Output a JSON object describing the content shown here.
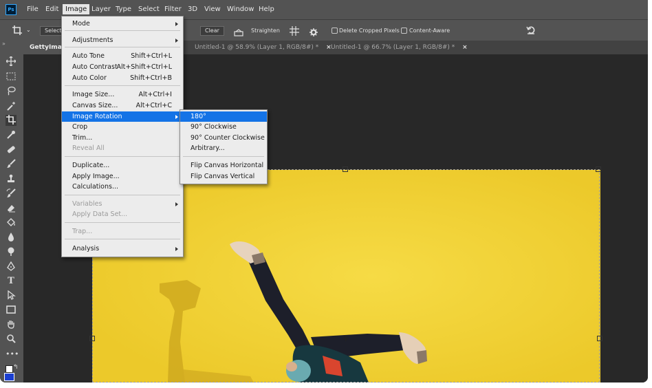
{
  "app": {
    "logo": "Ps",
    "accent": "#31a8ff"
  },
  "menubar": {
    "items": [
      "File",
      "Edit",
      "Image",
      "Layer",
      "Type",
      "Select",
      "Filter",
      "3D",
      "View",
      "Window",
      "Help"
    ],
    "active": "Image"
  },
  "options": {
    "select_partial": "Selecti",
    "clear": "Clear",
    "straighten": "Straighten",
    "delete_cropped": "Delete Cropped Pixels",
    "content_aware": "Content-Aware"
  },
  "tabs": [
    {
      "label": "GettyImag",
      "active": true
    },
    {
      "label": "Untitled-1 @ 58.9% (Layer 1, RGB/8#) *",
      "close": "×"
    },
    {
      "label": "Untitled-1 @ 66.7% (Layer 1, RGB/8#) *",
      "close": "×"
    }
  ],
  "image_menu": {
    "items": [
      {
        "label": "Mode",
        "submenu": true
      },
      {
        "label": "Adjustments",
        "submenu": true
      },
      {
        "label": "Auto Tone",
        "shortcut": "Shift+Ctrl+L"
      },
      {
        "label": "Auto Contrast",
        "shortcut": "Alt+Shift+Ctrl+L"
      },
      {
        "label": "Auto Color",
        "shortcut": "Shift+Ctrl+B"
      },
      {
        "label": "Image Size...",
        "shortcut": "Alt+Ctrl+I"
      },
      {
        "label": "Canvas Size...",
        "shortcut": "Alt+Ctrl+C"
      },
      {
        "label": "Image Rotation",
        "submenu": true,
        "highlighted": true
      },
      {
        "label": "Crop"
      },
      {
        "label": "Trim..."
      },
      {
        "label": "Reveal All",
        "disabled": true
      },
      {
        "label": "Duplicate..."
      },
      {
        "label": "Apply Image..."
      },
      {
        "label": "Calculations..."
      },
      {
        "label": "Variables",
        "submenu": true,
        "disabled": true
      },
      {
        "label": "Apply Data Set...",
        "disabled": true
      },
      {
        "label": "Trap...",
        "disabled": true
      },
      {
        "label": "Analysis",
        "submenu": true
      }
    ]
  },
  "rotation_submenu": {
    "items": [
      {
        "label": "180°",
        "highlighted": true
      },
      {
        "label": "90° Clockwise"
      },
      {
        "label": "90° Counter Clockwise"
      },
      {
        "label": "Arbitrary..."
      },
      {
        "label": "Flip Canvas Horizontal"
      },
      {
        "label": "Flip Canvas Vertical"
      }
    ]
  },
  "colors": {
    "menu_highlight": "#1473e6",
    "photo_background": "#f2d333",
    "foreground_swatch": "#1b3fd0"
  },
  "tools": [
    "move-icon",
    "marquee-icon",
    "lasso-icon",
    "magic-wand-icon",
    "crop-icon",
    "eyedropper-icon",
    "healing-brush-icon",
    "brush-icon",
    "clone-stamp-icon",
    "history-brush-icon",
    "eraser-icon",
    "paint-bucket-icon",
    "blur-icon",
    "dodge-icon",
    "pen-icon",
    "type-icon",
    "path-selection-icon",
    "rectangle-icon",
    "hand-icon",
    "zoom-icon",
    "more-tools-icon"
  ]
}
